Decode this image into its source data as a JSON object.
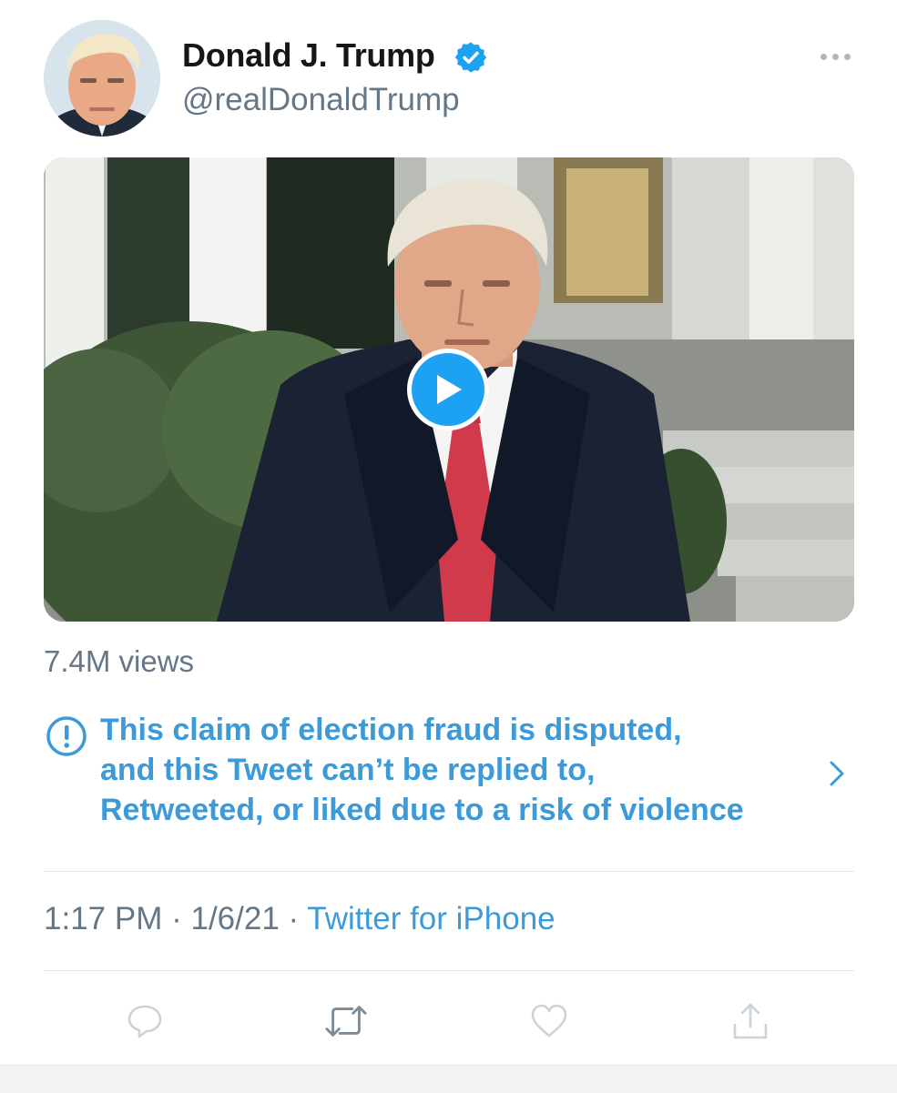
{
  "tweet": {
    "author": {
      "name": "Donald J. Trump",
      "handle": "@realDonaldTrump",
      "verified": true
    },
    "media": {
      "type": "video",
      "views_text": "7.4M views"
    },
    "notice": {
      "lines": [
        "This claim of election fraud is disputed,",
        "and this Tweet can’t be replied to,",
        "Retweeted, or liked due to a risk of violence"
      ]
    },
    "meta": {
      "time": "1:17 PM",
      "separator": "·",
      "date": "1/6/21",
      "source": "Twitter for iPhone"
    },
    "actions": [
      "reply-icon",
      "retweet-icon",
      "like-icon",
      "share-icon"
    ]
  },
  "colors": {
    "link_blue": "#3d9ad8",
    "twitter_blue": "#1da1f2",
    "secondary_text": "#657786",
    "action_icon_gray": "#cbd3d9"
  }
}
